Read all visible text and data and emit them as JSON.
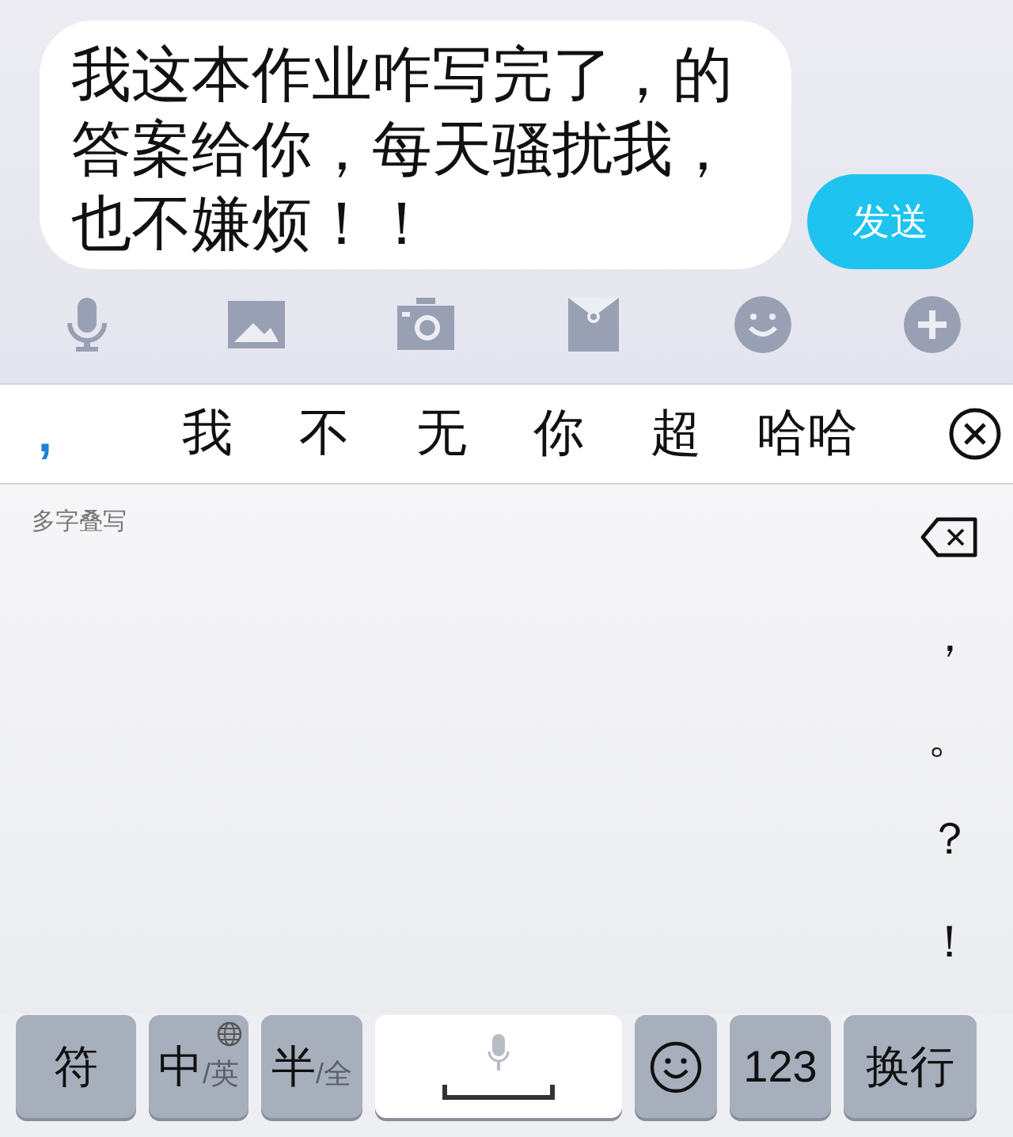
{
  "message_draft": {
    "text": "我这本作业咋写完了，的答案给你，每天骚扰我，也不嫌烦！！"
  },
  "send_button": {
    "label": "发送"
  },
  "toolbar": [
    {
      "kind": "mic"
    },
    {
      "kind": "image"
    },
    {
      "kind": "camera"
    },
    {
      "kind": "envelope"
    },
    {
      "kind": "emoji"
    },
    {
      "kind": "plus"
    }
  ],
  "candidates": [
    {
      "text": ",",
      "kind": "punct"
    },
    {
      "text": "我",
      "kind": "word"
    },
    {
      "text": "不",
      "kind": "word"
    },
    {
      "text": "无",
      "kind": "word"
    },
    {
      "text": "你",
      "kind": "word"
    },
    {
      "text": "超",
      "kind": "word"
    },
    {
      "text": "哈哈",
      "kind": "word"
    }
  ],
  "handwriting": {
    "mode_label": "多字叠写"
  },
  "side_keys": [
    {
      "kind": "delete"
    },
    {
      "kind": "char",
      "text": "，"
    },
    {
      "kind": "char",
      "text": "。"
    },
    {
      "kind": "char",
      "text": "？"
    },
    {
      "kind": "char",
      "text": "！"
    }
  ],
  "bottom_keys": [
    {
      "kind": "text",
      "text": "符"
    },
    {
      "kind": "dual",
      "text": "中",
      "sub": "/英",
      "globe": true
    },
    {
      "kind": "dual",
      "text": "半",
      "sub": "/全",
      "globe": false
    },
    {
      "kind": "space"
    },
    {
      "kind": "emoji"
    },
    {
      "kind": "text",
      "text": "123"
    },
    {
      "kind": "text",
      "text": "换行"
    }
  ]
}
